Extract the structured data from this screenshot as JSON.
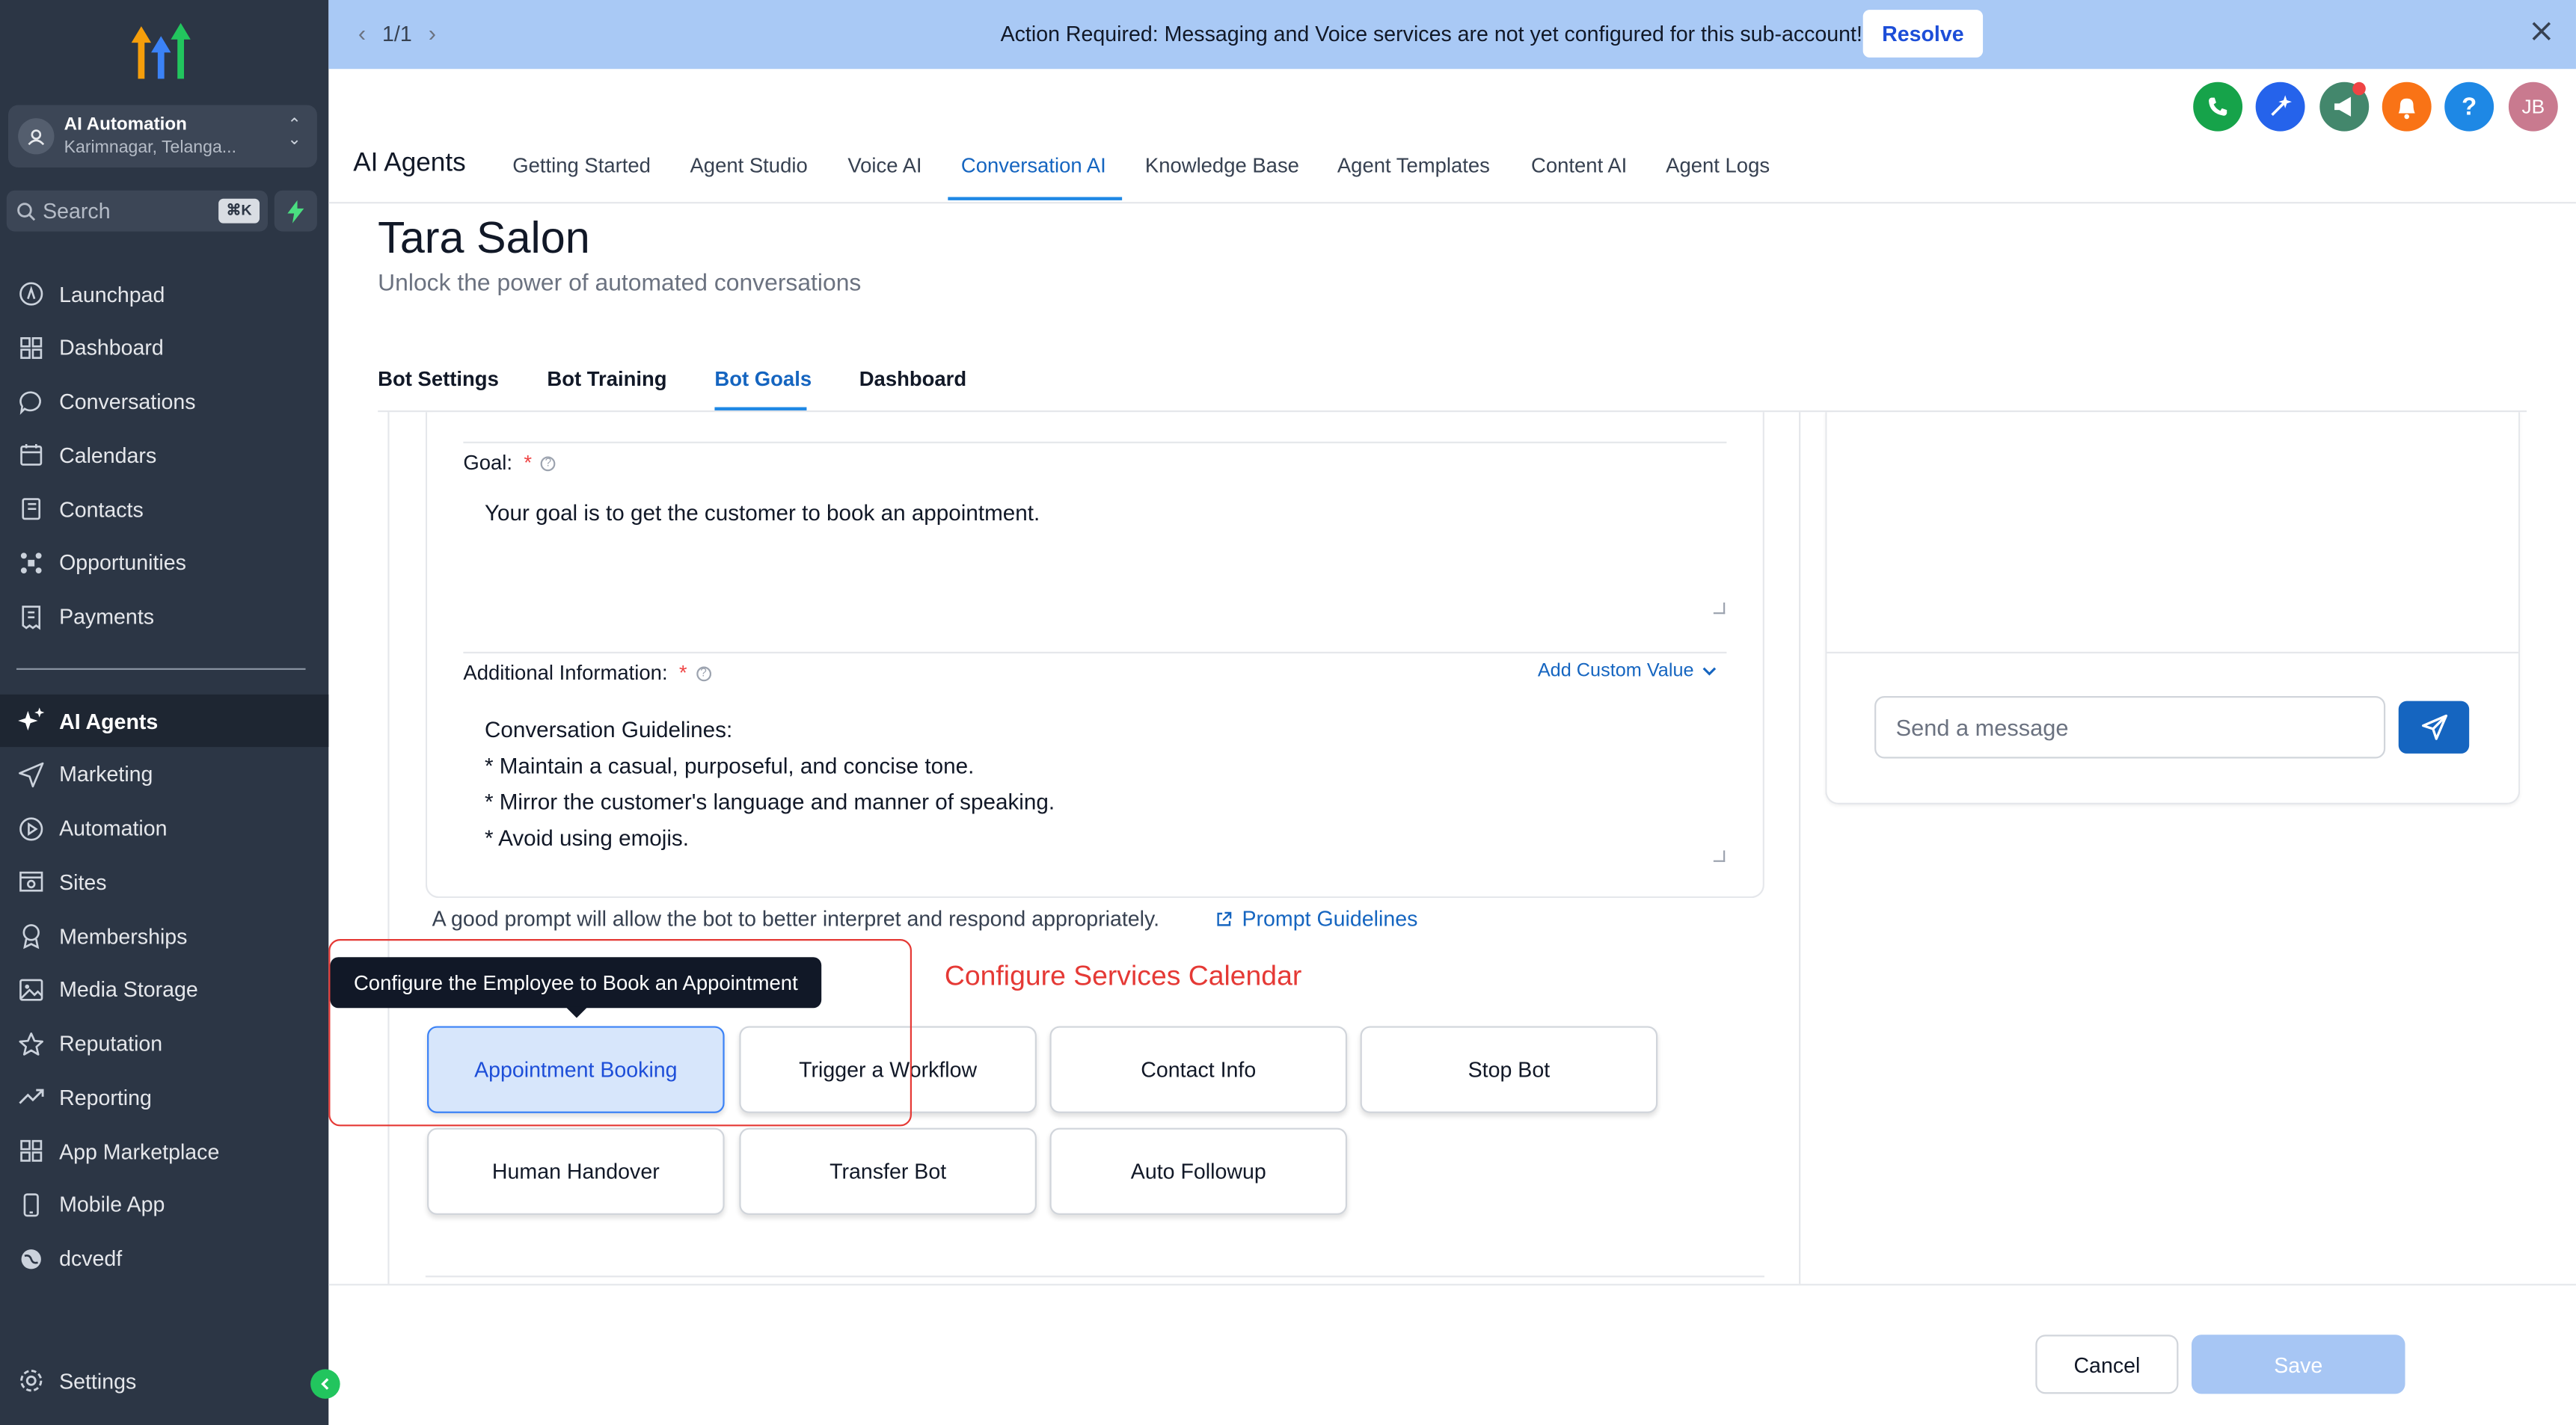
{
  "sidebar": {
    "account": {
      "name": "AI Automation",
      "location": "Karimnagar, Telanga..."
    },
    "search": {
      "placeholder": "Search",
      "shortcut": "⌘K"
    },
    "items": [
      {
        "label": "Launchpad",
        "icon": "rocket-icon"
      },
      {
        "label": "Dashboard",
        "icon": "grid-icon"
      },
      {
        "label": "Conversations",
        "icon": "chat-bubble-icon"
      },
      {
        "label": "Calendars",
        "icon": "calendar-icon"
      },
      {
        "label": "Contacts",
        "icon": "contacts-icon"
      },
      {
        "label": "Opportunities",
        "icon": "opportunities-icon"
      },
      {
        "label": "Payments",
        "icon": "receipt-icon"
      }
    ],
    "items2": [
      {
        "label": "AI Agents",
        "icon": "sparkle-icon",
        "active": true
      },
      {
        "label": "Marketing",
        "icon": "send-icon"
      },
      {
        "label": "Automation",
        "icon": "automation-icon"
      },
      {
        "label": "Sites",
        "icon": "sites-icon"
      },
      {
        "label": "Memberships",
        "icon": "award-icon"
      },
      {
        "label": "Media Storage",
        "icon": "image-icon"
      },
      {
        "label": "Reputation",
        "icon": "star-icon"
      },
      {
        "label": "Reporting",
        "icon": "trend-icon"
      },
      {
        "label": "App Marketplace",
        "icon": "apps-icon"
      },
      {
        "label": "Mobile App",
        "icon": "phone-icon"
      },
      {
        "label": "dcvedf",
        "icon": "globe-icon"
      }
    ],
    "settings": "Settings"
  },
  "banner": {
    "pager": "1/1",
    "message": "Action Required: Messaging and Voice services are not yet configured for this sub-account!",
    "resolve": "Resolve"
  },
  "header": {
    "avatar_initials": "JB",
    "app_title": "AI Agents",
    "tabs": [
      "Getting Started",
      "Agent Studio",
      "Voice AI",
      "Conversation AI",
      "Knowledge Base",
      "Agent Templates",
      "Content AI",
      "Agent Logs"
    ],
    "active_tab": "Conversation AI"
  },
  "page": {
    "title": "Tara Salon",
    "subtitle": "Unlock the power of automated conversations",
    "subtabs": [
      "Bot Settings",
      "Bot Training",
      "Bot Goals",
      "Dashboard"
    ],
    "active_subtab": "Bot Goals"
  },
  "form": {
    "goal_label": "Goal:",
    "goal_value": "Your goal is to get the customer to book an appointment.",
    "additional_label": "Additional Information:",
    "add_custom_value": "Add Custom Value",
    "additional_lines": [
      "Conversation Guidelines:",
      "* Maintain a casual, purposeful, and concise tone.",
      "* Mirror the customer's language and manner of speaking.",
      "* Avoid using emojis."
    ],
    "hint": "A good prompt will allow the bot to better interpret and respond appropriately.",
    "guidelines_link": "Prompt Guidelines"
  },
  "annotation": {
    "callout": "Configure Services Calendar",
    "tooltip": "Configure the Employee to Book an Appointment"
  },
  "goal_buttons": [
    "Appointment Booking",
    "Trigger a Workflow",
    "Contact Info",
    "Stop Bot",
    "Human Handover",
    "Transfer Bot",
    "Auto Followup"
  ],
  "chat": {
    "placeholder": "Send a message"
  },
  "footer": {
    "cancel": "Cancel",
    "save": "Save"
  },
  "colors": {
    "accent": "#1565c0",
    "sidebar": "#2c3645",
    "banner": "#a9c9f5",
    "callout": "#e53935"
  }
}
